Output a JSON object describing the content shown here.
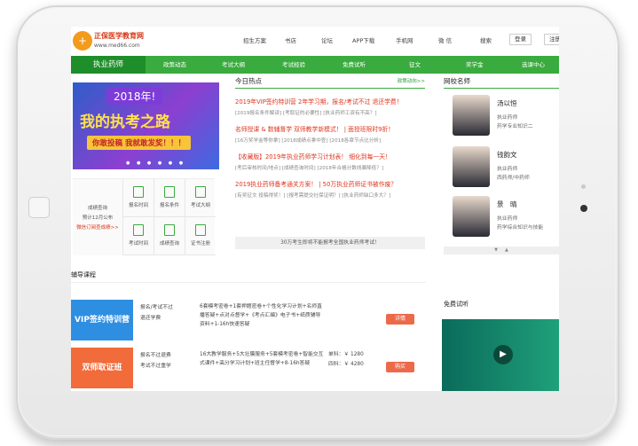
{
  "site": {
    "logo_text": "正保医学教育网",
    "logo_url": "www.med66.com"
  },
  "topnav": [
    "招生方案",
    "书店",
    "论坛",
    "APP下载",
    "手机网",
    "微 信",
    "搜索"
  ],
  "top_buttons": {
    "login": "登录",
    "register": "注册"
  },
  "mainnav": {
    "current": "执业药师",
    "items": [
      "政策动态",
      "考试大纲",
      "考试经验",
      "免费试听",
      "征文",
      "奖学金",
      "选课中心"
    ]
  },
  "banner": {
    "line1": "2018年!",
    "line2": "我的执考之路",
    "line3": "你敢投稿 我就敢发奖！！！"
  },
  "quick": {
    "left_title": "成绩查询",
    "left_sub": "预计12月公布",
    "left_link": "微信订阅查成绩>>",
    "cells": [
      "报名时间",
      "报名条件",
      "考试大纲",
      "考试时间",
      "成绩查询",
      "证书注册"
    ]
  },
  "hot": {
    "title": "今日热点",
    "more": "政策动向>>",
    "items": [
      {
        "headline": "2019年VIP签约特训营 2年学习期，报名/考试不过 退还学费！",
        "subs": "[2019报名条件解读] [考取证的必要性] [执业药师工资有不高？]"
      },
      {
        "headline": "名师授课 & 数辅督学 双师教学新模式！ | 面授班限时9折！",
        "subs": "[16万奖学金等你拿] [2018成绩点拿中查] [2018各章节点比分析]"
      },
      {
        "headline": "【收藏版】2019年执业药师学习计划表！ 细化到每一天！",
        "subs": "[考后审核时间/地点] [成绩查询时间] [2018年合格分数线暴降低？]"
      },
      {
        "headline": "2019执业药师备考通关方案！ | 50万执业药师证书被作废？",
        "subs": "[有奖征文 投稿得奖！] [报考需提交社保证明？] [执业药师缺口多大？]"
      }
    ],
    "note": "30万考生即将不能报考全国执业药师考试！"
  },
  "teachers": {
    "title": "网校名师",
    "list": [
      {
        "name": "汤以恒",
        "role": "执业药师",
        "desc": "药学专业知识二"
      },
      {
        "name": "钱韵文",
        "role": "执业药师",
        "desc": "西药师/中药师"
      },
      {
        "name": "景　晴",
        "role": "执业药师",
        "desc": "药学综合知识与技能"
      }
    ]
  },
  "courses": {
    "title": "辅导课程",
    "list": [
      {
        "tag": "VIP签约特训营",
        "desc": "报名/考试不过\n退还学费",
        "detail": "6套模考密卷+1套押题密卷+个性化学习计划+名师直播答疑+点对点督学+《考点汇编》电子书+纸质辅导资料+1-16h快速答疑",
        "price": "",
        "button": "详情",
        "color": "#2e8fe2"
      },
      {
        "tag": "双师取证班",
        "desc": "报名不过退费\n考试不过重学",
        "detail": "16大教学服务+5大壮膜服务+5套模考密卷+智能交互式课件+高分学习计划+班主任督学+8-16h答疑",
        "price": "单科：￥ 1280\n四科：￥ 4280",
        "button": "购买",
        "color": "#f26b3a"
      }
    ]
  },
  "free_trial": {
    "title": "免费试听"
  }
}
